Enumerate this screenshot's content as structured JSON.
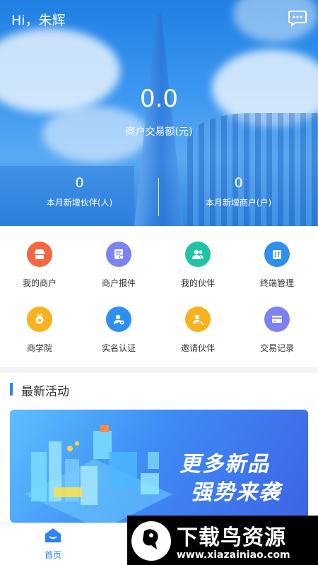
{
  "header": {
    "greeting": "Hi，朱辉",
    "amount": "0.0",
    "amount_label": "商户交易额(元)",
    "stats": [
      {
        "value": "0",
        "label": "本月新增伙伴(人)"
      },
      {
        "value": "0",
        "label": "本月新增商户(户)"
      }
    ]
  },
  "menu": [
    {
      "label": "我的商户",
      "icon": "store-icon",
      "color": "#f4663f"
    },
    {
      "label": "商户报件",
      "icon": "report-icon",
      "color": "#7b83f2"
    },
    {
      "label": "我的伙伴",
      "icon": "partners-icon",
      "color": "#22c3a5"
    },
    {
      "label": "终端管理",
      "icon": "terminal-icon",
      "color": "#2e8ff0"
    },
    {
      "label": "商学院",
      "icon": "academy-icon",
      "color": "#f8b21f"
    },
    {
      "label": "实名认证",
      "icon": "verify-icon",
      "color": "#2e8ff0"
    },
    {
      "label": "邀请伙伴",
      "icon": "invite-icon",
      "color": "#f8b21f"
    },
    {
      "label": "交易记录",
      "icon": "card-icon",
      "color": "#7b83f2"
    }
  ],
  "activities": {
    "title": "最新活动",
    "banner_line1": "更多新品",
    "banner_line2": "强势来袭"
  },
  "nav": {
    "home_label": "首页"
  },
  "watermark": {
    "main": "下载鸟资源",
    "sub": "www.xiazainiao.com"
  }
}
